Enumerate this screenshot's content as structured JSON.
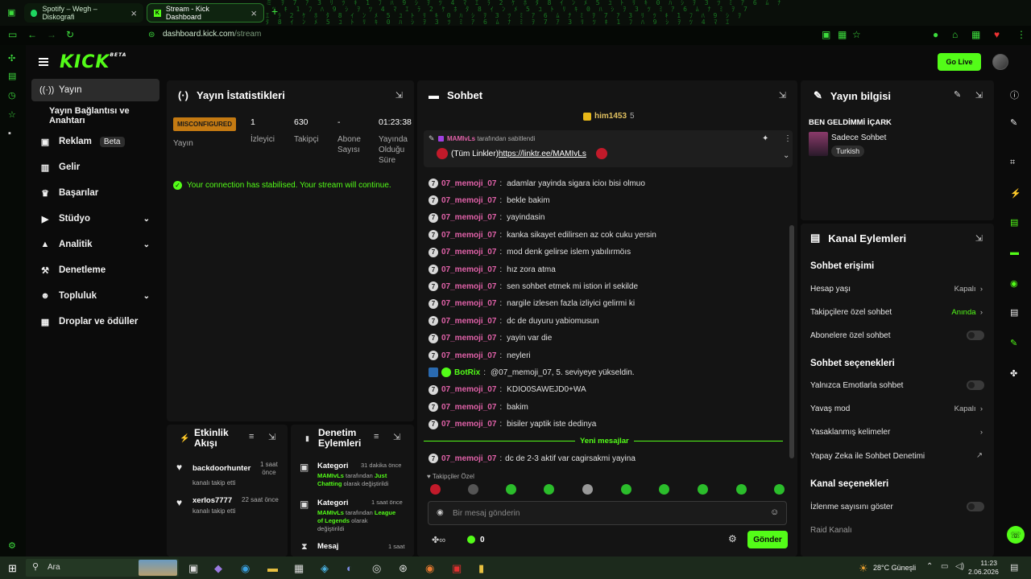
{
  "browser": {
    "tabs": [
      {
        "title": "Spotify – Wegh – Diskografi"
      },
      {
        "title": "Stream - Kick Dashboard"
      }
    ],
    "url_host": "dashboard.kick.com",
    "url_path": "/stream"
  },
  "header": {
    "logo": "KICK",
    "logo_suffix": "BETA",
    "go_live": "Go Live"
  },
  "sidebar": {
    "items": [
      {
        "label": "Yayın",
        "icon": "broadcast-icon"
      },
      {
        "label": "Yayın Bağlantısı ve Anahtarı"
      },
      {
        "label": "Reklam",
        "badge": "Beta",
        "icon": "video-icon"
      },
      {
        "label": "Gelir",
        "icon": "chart-icon"
      },
      {
        "label": "Başarılar",
        "icon": "trophy-icon"
      },
      {
        "label": "Stüdyo",
        "icon": "camera-icon"
      },
      {
        "label": "Analitik",
        "icon": "analytics-icon"
      },
      {
        "label": "Denetleme",
        "icon": "hammer-icon"
      },
      {
        "label": "Topluluk",
        "icon": "users-icon"
      },
      {
        "label": "Droplar ve ödüller",
        "icon": "gift-icon"
      }
    ]
  },
  "stats": {
    "title": "Yayın İstatistikleri",
    "status": "MISCONFIGURED",
    "status_label": "Yayın",
    "viewers_value": "1",
    "viewers_label": "İzleyici",
    "followers_value": "630",
    "followers_label": "Takipçi",
    "subs_value": "-",
    "subs_label1": "Abone",
    "subs_label2": "Sayısı",
    "uptime_value": "01:23:38",
    "uptime_label1": "Yayında",
    "uptime_label2": "Olduğu",
    "uptime_label3": "Süre",
    "notice": "Your connection has stabilised. Your stream will continue."
  },
  "activity": {
    "title1": "Etkinlik",
    "title2": "Akışı",
    "events": [
      {
        "user": "backdoorhunter",
        "text": "kanalı takip etti",
        "time1": "1 saat",
        "time2": "önce"
      },
      {
        "user": "xerlos7777",
        "text": "kanalı takip etti",
        "time1": "22 saat önce",
        "time2": ""
      }
    ]
  },
  "moderation": {
    "title1": "Denetim",
    "title2": "Eylemleri",
    "items": [
      {
        "type": "Kategori",
        "time": "31 dakika önce",
        "user": "MAMIvLs",
        "mid": "tarafından",
        "cat1": "Just",
        "cat2": "Chatting",
        "tail": "olarak değiştirildi"
      },
      {
        "type": "Kategori",
        "time": "1 saat önce",
        "user": "MAMIvLs",
        "mid": "tarafından",
        "cat1": "League",
        "cat2": "of Legends",
        "tail": "olarak",
        "tail2": "değiştirildi"
      },
      {
        "type": "Mesaj",
        "time": "1 saat"
      }
    ]
  },
  "chat": {
    "title": "Sohbet",
    "top_user": "him1453",
    "top_count": "5",
    "pinned_by_user": "MAMIvLs",
    "pinned_by_text": "tarafından sabitlendi",
    "pinned_prefix": "(Tüm Linkler)",
    "pinned_link": "https://linktr.ee/MAMIvLs",
    "messages": [
      {
        "user": "07_memoji_07",
        "text": "adamlar yayinda sigara icioı bisi olmuo"
      },
      {
        "user": "07_memoji_07",
        "text": "bekle bakim"
      },
      {
        "user": "07_memoji_07",
        "text": "yayindasin"
      },
      {
        "user": "07_memoji_07",
        "text": "kanka sikayet edilirsen az cok cuku yersin"
      },
      {
        "user": "07_memoji_07",
        "text": "mod denk gelirse islem yabılırmöıs"
      },
      {
        "user": "07_memoji_07",
        "text": "hız zora atma"
      },
      {
        "user": "07_memoji_07",
        "text": "sen sohbet etmek mi istion irl sekilde"
      },
      {
        "user": "07_memoji_07",
        "text": "nargile izlesen fazla izliyici gelirmi ki"
      },
      {
        "user": "07_memoji_07",
        "text": "dc de duyuru yabiomusun"
      },
      {
        "user": "07_memoji_07",
        "text": "yayin var die"
      },
      {
        "user": "07_memoji_07",
        "text": "neyleri"
      },
      {
        "user": "BotRix",
        "text": "@07_memoji_07, 5. seviyeye yükseldin."
      },
      {
        "user": "07_memoji_07",
        "text": "KDIO0SAWEJD0+WA"
      },
      {
        "user": "07_memoji_07",
        "text": "bakim"
      },
      {
        "user": "07_memoji_07",
        "text": "bisiler yaptik iste dedinya"
      }
    ],
    "new_messages": "Yeni mesajlar",
    "last_message": {
      "user": "07_memoji_07",
      "text": "dc de 2-3 aktif var cagirsakmi yayina"
    },
    "followers_only": "Takipçiler Özel",
    "input_placeholder": "Bir mesaj gönderin",
    "points": "0",
    "send": "Gönder"
  },
  "stream_info": {
    "title": "Yayın bilgisi",
    "stream_title": "BEN GELDİMMİ İÇARK",
    "category": "Sadece Sohbet",
    "tag": "Turkish"
  },
  "channel_actions": {
    "title": "Kanal Eylemleri",
    "chat_access": "Sohbet erişimi",
    "account_age": "Hesap yaşı",
    "account_age_value": "Kapalı",
    "followers_chat": "Takipçilere özel sohbet",
    "followers_chat_value": "Anında",
    "subs_chat": "Abonelere özel sohbet",
    "chat_options": "Sohbet seçenekleri",
    "emote_only": "Yalnızca Emotlarla sohbet",
    "slow_mode": "Yavaş mod",
    "slow_mode_value": "Kapalı",
    "banned_words": "Yasaklanmış kelimeler",
    "ai_moderation": "Yapay Zeka ile Sohbet Denetimi",
    "channel_options": "Kanal seçenekleri",
    "show_viewers": "İzlenme sayısını göster",
    "raid_channel": "Raid Kanalı"
  },
  "taskbar": {
    "search": "Ara",
    "weather": "28°C  Güneşli",
    "time": "11:23",
    "date": "2.06.2026"
  },
  "colors": {
    "accent": "#53fc18",
    "panel": "#141414",
    "username": "#e061a8",
    "warning": "#c47a12"
  }
}
